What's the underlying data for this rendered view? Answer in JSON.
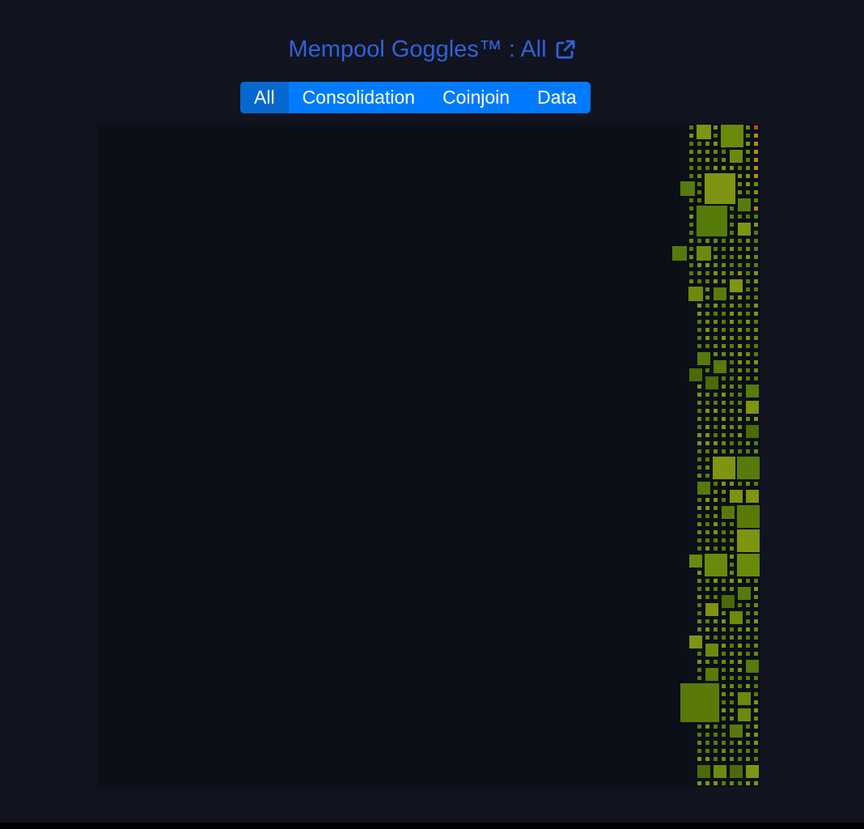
{
  "header": {
    "title": "Mempool Goggles™ : All",
    "link_icon": "external-link-icon",
    "title_color": "#2e63d8"
  },
  "filters": {
    "items": [
      {
        "label": "All",
        "active": true
      },
      {
        "label": "Consolidation",
        "active": false
      },
      {
        "label": "Coinjoin",
        "active": false
      },
      {
        "label": "Data",
        "active": false
      }
    ],
    "accent_color": "#007bff",
    "active_color": "#0568d1"
  },
  "block_graph": {
    "background": "#0b0f17",
    "palette": [
      "#567b0a",
      "#6a8a0c",
      "#7f9410",
      "#5a7a08",
      "#4a6a06",
      "#8b8f12",
      "#b08914",
      "#c04040"
    ]
  }
}
